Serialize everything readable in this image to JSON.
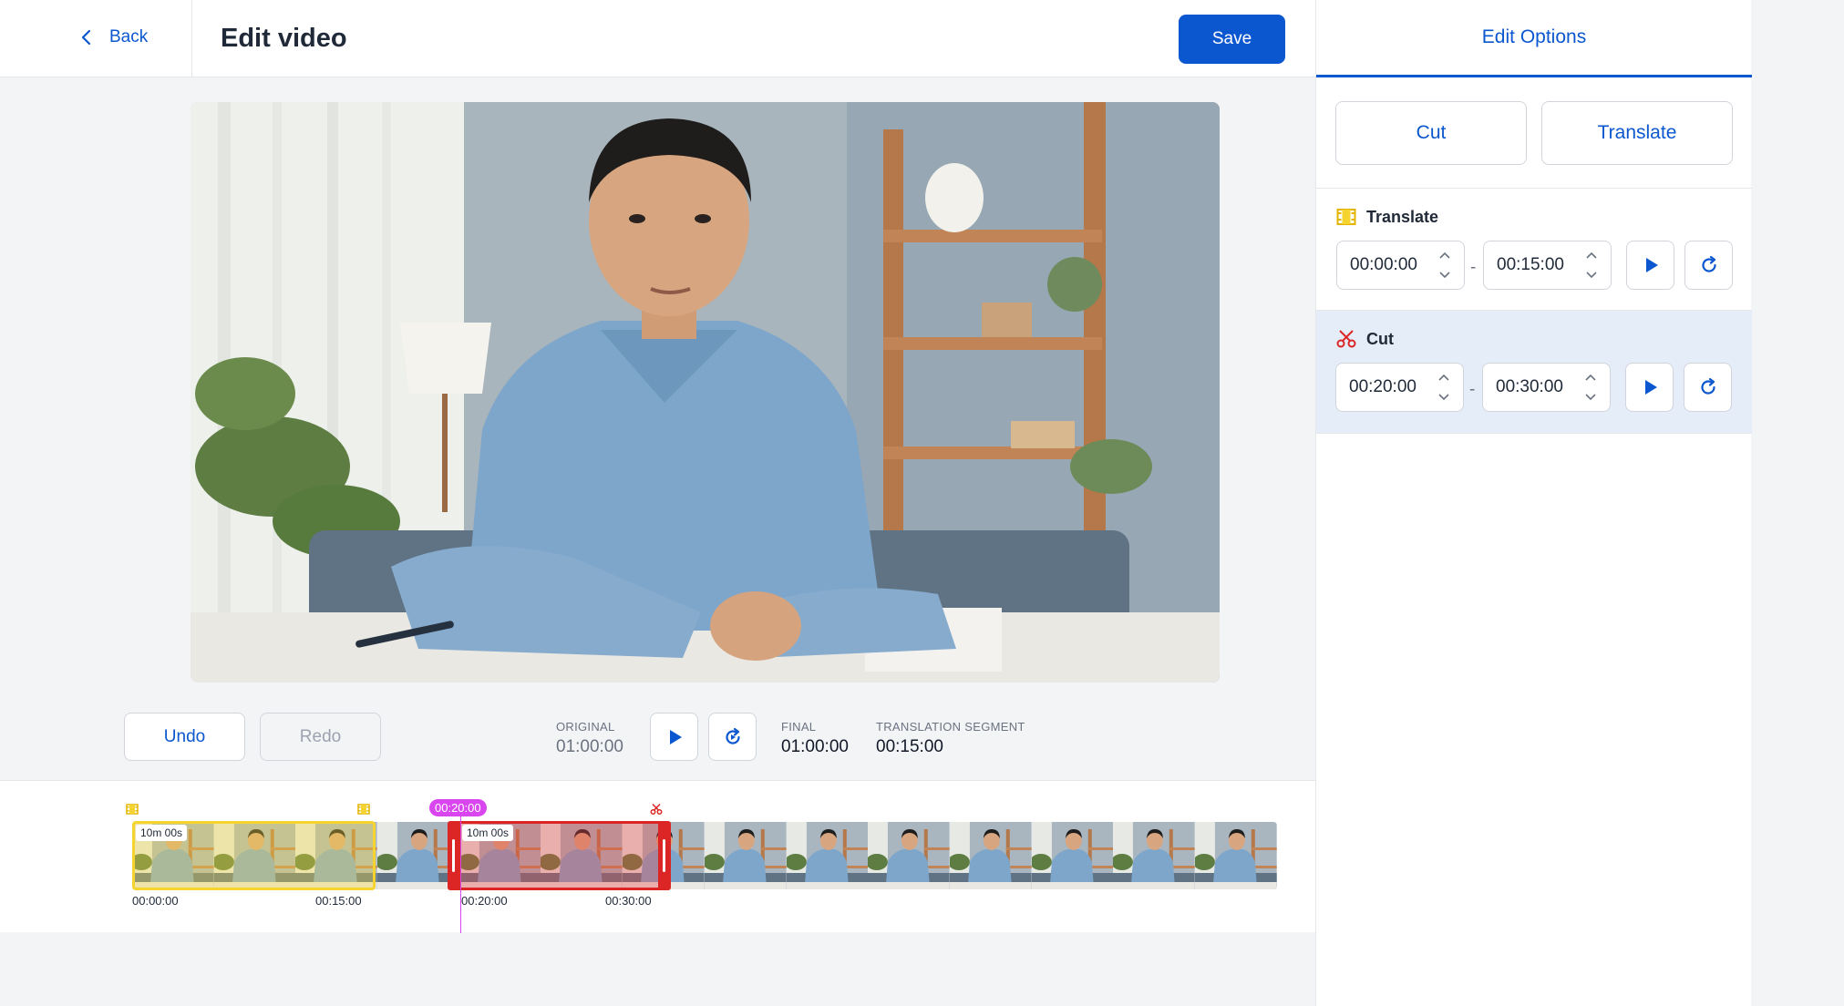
{
  "header": {
    "back_label": "Back",
    "title": "Edit video",
    "save_label": "Save"
  },
  "controls": {
    "undo_label": "Undo",
    "redo_label": "Redo",
    "original_label": "ORIGINAL",
    "original_value": "01:00:00",
    "final_label": "FINAL",
    "final_value": "01:00:00",
    "segment_label": "TRANSLATION SEGMENT",
    "segment_value": "00:15:00"
  },
  "timeline": {
    "playhead_time": "00:20:00",
    "duration_badge_1": "10m 00s",
    "duration_badge_2": "10m 00s",
    "ticks": [
      "00:00:00",
      "00:15:00",
      "00:20:00",
      "00:30:00"
    ],
    "thumbnail_count": 14
  },
  "panel": {
    "tab_label": "Edit Options",
    "cut_button": "Cut",
    "translate_button": "Translate",
    "edits": [
      {
        "type": "translate",
        "label": "Translate",
        "start": "00:00:00",
        "end": "00:15:00",
        "icon": "film-icon",
        "color": "#f5d430"
      },
      {
        "type": "cut",
        "label": "Cut",
        "start": "00:20:00",
        "end": "00:30:00",
        "icon": "scissors-icon",
        "color": "#dc2626"
      }
    ],
    "separator": "-"
  },
  "colors": {
    "accent": "#0b57d0",
    "translate": "#f5d430",
    "cut": "#dc2626",
    "playhead": "#d946ef"
  }
}
